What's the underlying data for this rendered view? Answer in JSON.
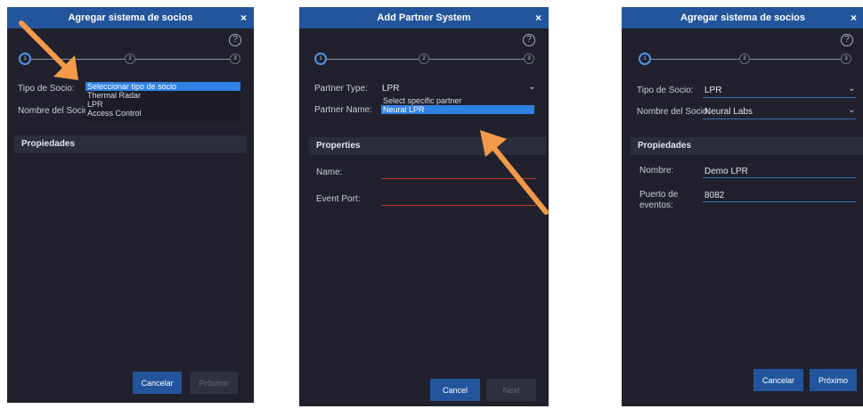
{
  "panel1": {
    "title": "Agregar sistema de socios",
    "close": "×",
    "steps": [
      "1",
      "2",
      "3"
    ],
    "type_label": "Tipo de Socio:",
    "name_label": "Nombre del Socio:",
    "options": [
      "Seleccionar tipo de socio",
      "Thermal Radar",
      "LPR",
      "Access Control"
    ],
    "section": "Propiedades",
    "cancel": "Cancelar",
    "next": "Próximo"
  },
  "panel2": {
    "title": "Add Partner System",
    "close": "×",
    "steps": [
      "1",
      "2",
      "3"
    ],
    "type_label": "Partner Type:",
    "type_value": "LPR",
    "name_label": "Partner Name:",
    "options": [
      "Select specific partner",
      "Neural LPR"
    ],
    "section": "Properties",
    "field1_label": "Name:",
    "field2_label": "Event Port:",
    "cancel": "Cancel",
    "next": "Next"
  },
  "panel3": {
    "title": "Agregar sistema de socios",
    "close": "×",
    "steps": [
      "1",
      "2",
      "3"
    ],
    "type_label": "Tipo de Socio:",
    "type_value": "LPR",
    "name_label": "Nombre del Socio:",
    "name_value": "Neural Labs",
    "section": "Propiedades",
    "field1_label": "Nombre:",
    "field1_value": "Demo LPR",
    "field2_label": "Puerto de eventos:",
    "field2_value": "8082",
    "cancel": "Cancelar",
    "next": "Próximo"
  },
  "icons": {
    "help": "question-circle-icon",
    "dropdown": "chevron-down-icon",
    "close": "close-icon",
    "annotation": "arrow-annotation"
  },
  "colors": {
    "panel_bg": "#20212c",
    "title_bar": "#23559c",
    "selected_option": "#2f81e4",
    "active_step": "#4f93e5",
    "required_line": "#c0392b",
    "filled_line": "#3a6fb3",
    "arrow": "#f39a4a"
  }
}
